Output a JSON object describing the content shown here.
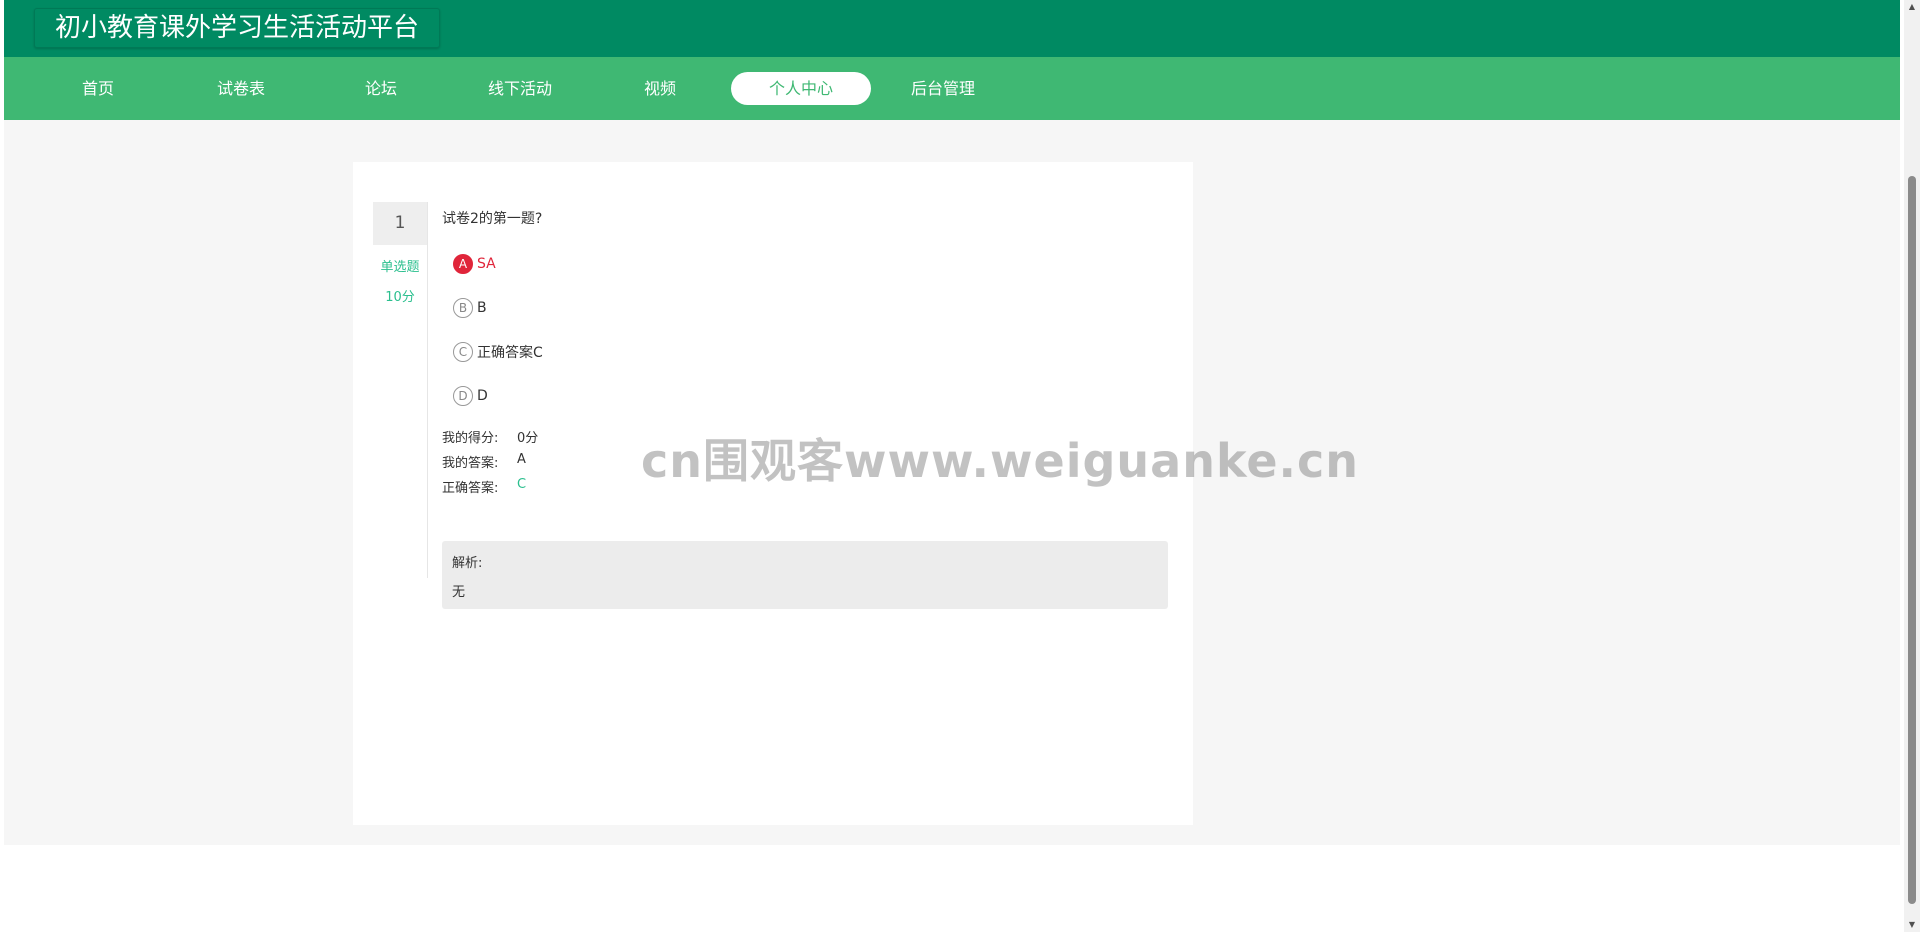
{
  "site": {
    "title": "初小教育课外学习生活活动平台"
  },
  "nav": {
    "items": [
      {
        "label": "首页"
      },
      {
        "label": "试卷表"
      },
      {
        "label": "论坛"
      },
      {
        "label": "线下活动"
      },
      {
        "label": "视频"
      },
      {
        "label": "个人中心",
        "active": true
      },
      {
        "label": "后台管理"
      }
    ]
  },
  "question": {
    "number": "1",
    "type": "单选题",
    "points": "10分",
    "text": "试卷2的第一题?",
    "options": [
      {
        "letter": "A",
        "label": "SA",
        "selected": true
      },
      {
        "letter": "B",
        "label": "B"
      },
      {
        "letter": "C",
        "label": "正确答案C"
      },
      {
        "letter": "D",
        "label": "D"
      }
    ],
    "my_score_label": "我的得分:",
    "my_score": "0分",
    "my_answer_label": "我的答案:",
    "my_answer": "A",
    "correct_answer_label": "正确答案:",
    "correct_answer": "C",
    "analysis_label": "解析:",
    "analysis_text": "无"
  },
  "watermark": "cn围观客www.weiguanke.cn",
  "colors": {
    "header": "#008a62",
    "nav": "#3fb873",
    "accent_green": "#2bbf8e",
    "selected_red": "#e0253a"
  }
}
